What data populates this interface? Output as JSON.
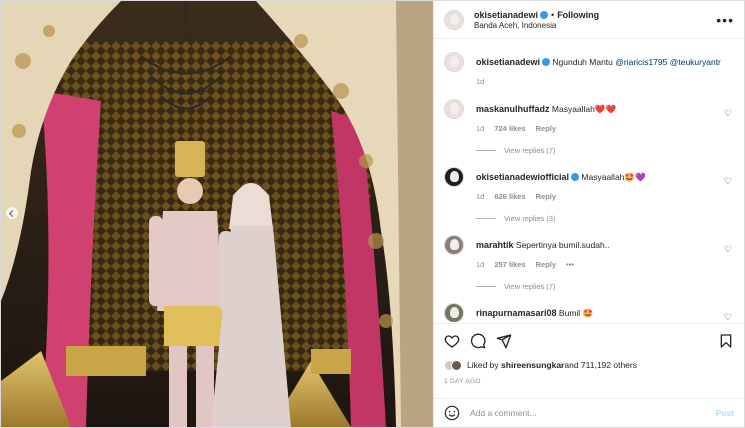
{
  "post": {
    "author": "okisetianadewi",
    "follow_label": "Following",
    "location": "Banda Aceh, Indonesia",
    "more_label": "•••"
  },
  "caption": {
    "author": "okisetianadewi",
    "text_prefix": "Ngunduh Mantu ",
    "mention1": "@riaricis1795",
    "mention2": "@teukuryantr",
    "time": "1d"
  },
  "comments": [
    {
      "user": "maskanulhuffadz",
      "text": "Masyaallah❤️❤️",
      "time": "1d",
      "likes": "724 likes",
      "reply": "Reply",
      "view_replies": "View replies (7)",
      "verified": false
    },
    {
      "user": "okisetianadewiofficial",
      "text": "Masyaallah🤩💜",
      "time": "1d",
      "likes": "626 likes",
      "reply": "Reply",
      "view_replies": "View replies (3)",
      "verified": true
    },
    {
      "user": "marahtik",
      "text": "Sepertinya bumil.sudah..",
      "time": "1d",
      "likes": "257 likes",
      "reply": "Reply",
      "view_replies": "View replies (7)",
      "verified": false,
      "has_more": "•••"
    },
    {
      "user": "rinapurnamasari08",
      "text": "Bumil 🤩",
      "time": "",
      "likes": "",
      "reply": "",
      "view_replies": "",
      "verified": false
    }
  ],
  "likes": {
    "prefix": "Liked by ",
    "user": "shireensungkar",
    "suffix": " and 711,192 others"
  },
  "time_ago": "1 DAY AGO",
  "add_comment": {
    "placeholder": "Add a comment...",
    "post_label": "Post"
  },
  "colors": {
    "accent": "#3897f0",
    "heart": "#ed4956",
    "post_disabled": "#b2dffc"
  }
}
